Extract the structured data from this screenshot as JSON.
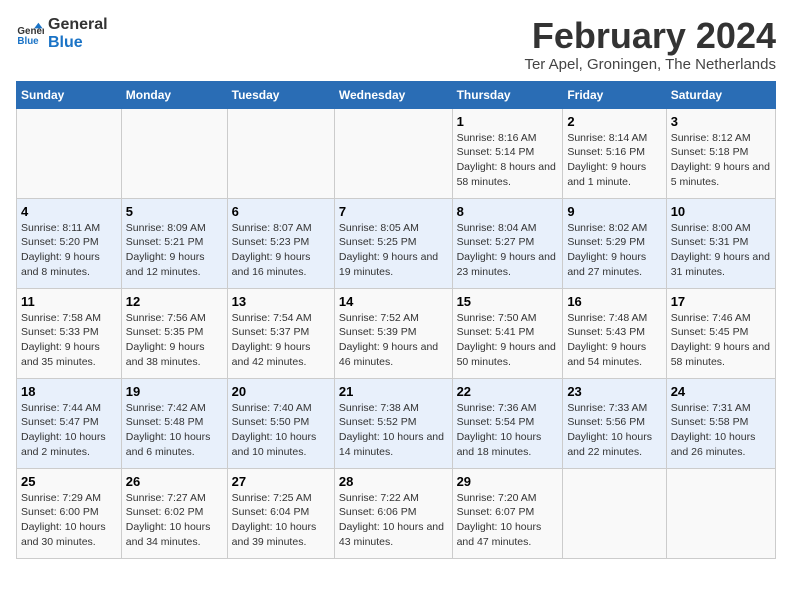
{
  "logo": {
    "line1": "General",
    "line2": "Blue"
  },
  "title": "February 2024",
  "subtitle": "Ter Apel, Groningen, The Netherlands",
  "days_of_week": [
    "Sunday",
    "Monday",
    "Tuesday",
    "Wednesday",
    "Thursday",
    "Friday",
    "Saturday"
  ],
  "weeks": [
    [
      {
        "day": "",
        "info": ""
      },
      {
        "day": "",
        "info": ""
      },
      {
        "day": "",
        "info": ""
      },
      {
        "day": "",
        "info": ""
      },
      {
        "day": "1",
        "info": "Sunrise: 8:16 AM\nSunset: 5:14 PM\nDaylight: 8 hours and 58 minutes."
      },
      {
        "day": "2",
        "info": "Sunrise: 8:14 AM\nSunset: 5:16 PM\nDaylight: 9 hours and 1 minute."
      },
      {
        "day": "3",
        "info": "Sunrise: 8:12 AM\nSunset: 5:18 PM\nDaylight: 9 hours and 5 minutes."
      }
    ],
    [
      {
        "day": "4",
        "info": "Sunrise: 8:11 AM\nSunset: 5:20 PM\nDaylight: 9 hours and 8 minutes."
      },
      {
        "day": "5",
        "info": "Sunrise: 8:09 AM\nSunset: 5:21 PM\nDaylight: 9 hours and 12 minutes."
      },
      {
        "day": "6",
        "info": "Sunrise: 8:07 AM\nSunset: 5:23 PM\nDaylight: 9 hours and 16 minutes."
      },
      {
        "day": "7",
        "info": "Sunrise: 8:05 AM\nSunset: 5:25 PM\nDaylight: 9 hours and 19 minutes."
      },
      {
        "day": "8",
        "info": "Sunrise: 8:04 AM\nSunset: 5:27 PM\nDaylight: 9 hours and 23 minutes."
      },
      {
        "day": "9",
        "info": "Sunrise: 8:02 AM\nSunset: 5:29 PM\nDaylight: 9 hours and 27 minutes."
      },
      {
        "day": "10",
        "info": "Sunrise: 8:00 AM\nSunset: 5:31 PM\nDaylight: 9 hours and 31 minutes."
      }
    ],
    [
      {
        "day": "11",
        "info": "Sunrise: 7:58 AM\nSunset: 5:33 PM\nDaylight: 9 hours and 35 minutes."
      },
      {
        "day": "12",
        "info": "Sunrise: 7:56 AM\nSunset: 5:35 PM\nDaylight: 9 hours and 38 minutes."
      },
      {
        "day": "13",
        "info": "Sunrise: 7:54 AM\nSunset: 5:37 PM\nDaylight: 9 hours and 42 minutes."
      },
      {
        "day": "14",
        "info": "Sunrise: 7:52 AM\nSunset: 5:39 PM\nDaylight: 9 hours and 46 minutes."
      },
      {
        "day": "15",
        "info": "Sunrise: 7:50 AM\nSunset: 5:41 PM\nDaylight: 9 hours and 50 minutes."
      },
      {
        "day": "16",
        "info": "Sunrise: 7:48 AM\nSunset: 5:43 PM\nDaylight: 9 hours and 54 minutes."
      },
      {
        "day": "17",
        "info": "Sunrise: 7:46 AM\nSunset: 5:45 PM\nDaylight: 9 hours and 58 minutes."
      }
    ],
    [
      {
        "day": "18",
        "info": "Sunrise: 7:44 AM\nSunset: 5:47 PM\nDaylight: 10 hours and 2 minutes."
      },
      {
        "day": "19",
        "info": "Sunrise: 7:42 AM\nSunset: 5:48 PM\nDaylight: 10 hours and 6 minutes."
      },
      {
        "day": "20",
        "info": "Sunrise: 7:40 AM\nSunset: 5:50 PM\nDaylight: 10 hours and 10 minutes."
      },
      {
        "day": "21",
        "info": "Sunrise: 7:38 AM\nSunset: 5:52 PM\nDaylight: 10 hours and 14 minutes."
      },
      {
        "day": "22",
        "info": "Sunrise: 7:36 AM\nSunset: 5:54 PM\nDaylight: 10 hours and 18 minutes."
      },
      {
        "day": "23",
        "info": "Sunrise: 7:33 AM\nSunset: 5:56 PM\nDaylight: 10 hours and 22 minutes."
      },
      {
        "day": "24",
        "info": "Sunrise: 7:31 AM\nSunset: 5:58 PM\nDaylight: 10 hours and 26 minutes."
      }
    ],
    [
      {
        "day": "25",
        "info": "Sunrise: 7:29 AM\nSunset: 6:00 PM\nDaylight: 10 hours and 30 minutes."
      },
      {
        "day": "26",
        "info": "Sunrise: 7:27 AM\nSunset: 6:02 PM\nDaylight: 10 hours and 34 minutes."
      },
      {
        "day": "27",
        "info": "Sunrise: 7:25 AM\nSunset: 6:04 PM\nDaylight: 10 hours and 39 minutes."
      },
      {
        "day": "28",
        "info": "Sunrise: 7:22 AM\nSunset: 6:06 PM\nDaylight: 10 hours and 43 minutes."
      },
      {
        "day": "29",
        "info": "Sunrise: 7:20 AM\nSunset: 6:07 PM\nDaylight: 10 hours and 47 minutes."
      },
      {
        "day": "",
        "info": ""
      },
      {
        "day": "",
        "info": ""
      }
    ]
  ]
}
